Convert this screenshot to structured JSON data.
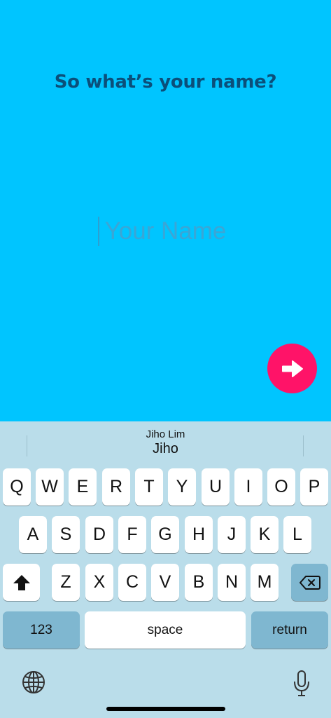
{
  "screen": {
    "title": "So what’s your name?",
    "name_input": {
      "placeholder": "Your Name",
      "value": ""
    },
    "next_button_icon": "arrow-right-icon"
  },
  "keyboard": {
    "suggestion": {
      "full": "Jiho Lim",
      "first": "Jiho"
    },
    "row1": [
      "Q",
      "W",
      "E",
      "R",
      "T",
      "Y",
      "U",
      "I",
      "O",
      "P"
    ],
    "row2": [
      "A",
      "S",
      "D",
      "F",
      "G",
      "H",
      "J",
      "K",
      "L"
    ],
    "row3": [
      "Z",
      "X",
      "C",
      "V",
      "B",
      "N",
      "M"
    ],
    "numbers_label": "123",
    "space_label": "space",
    "return_label": "return",
    "icons": [
      "shift-icon",
      "backspace-icon",
      "globe-icon",
      "microphone-icon"
    ]
  },
  "colors": {
    "background": "#00C5FF",
    "title": "#0B4F7A",
    "placeholder": "#3AA6D6",
    "next_button": "#FF1368",
    "keyboard": "#BADDEA",
    "key": "#FFFFFF",
    "key_dark": "#7FB7D0"
  }
}
